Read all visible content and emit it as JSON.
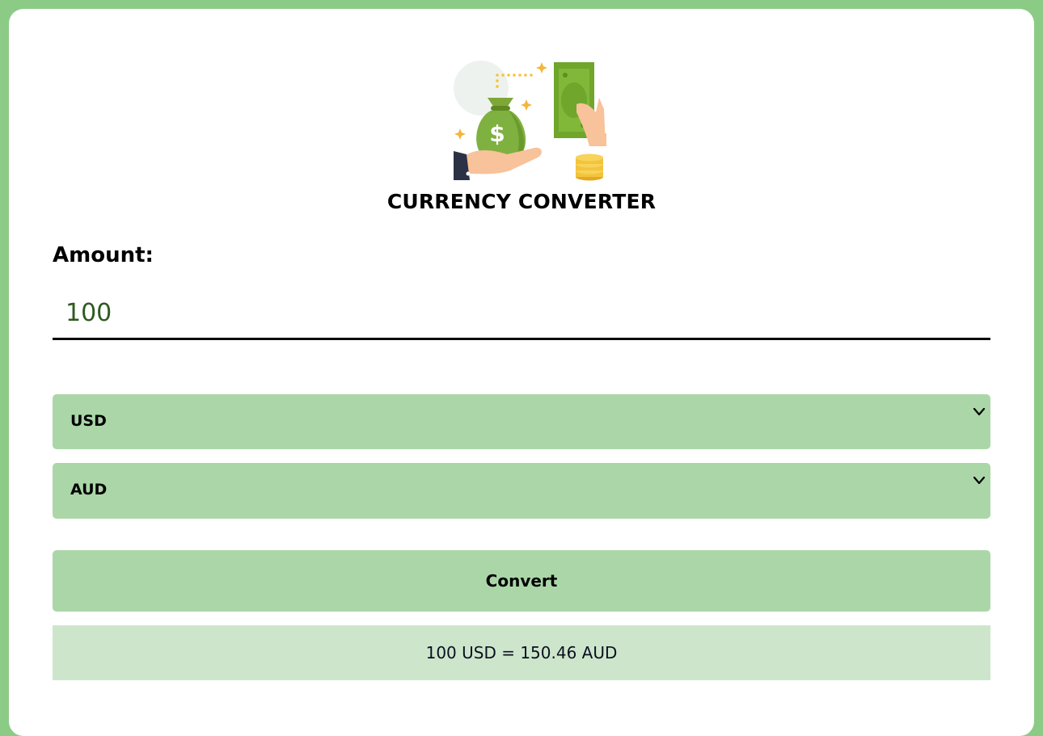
{
  "app": {
    "title": "CURRENCY CONVERTER"
  },
  "amount": {
    "label": "Amount:",
    "value": "100"
  },
  "from_currency": {
    "selected": "USD"
  },
  "to_currency": {
    "selected": "AUD"
  },
  "convert": {
    "label": "Convert"
  },
  "result": {
    "text": "100 USD = 150.46 AUD"
  },
  "icons": {
    "illustration": "money-exchange-illustration-icon",
    "dropdown": "chevron-down-icon"
  },
  "colors": {
    "page_background": "#8bcb86",
    "card_background": "#ffffff",
    "control_background": "#abd7a8",
    "result_background": "#cde6cb",
    "input_text": "#2f5a20"
  }
}
